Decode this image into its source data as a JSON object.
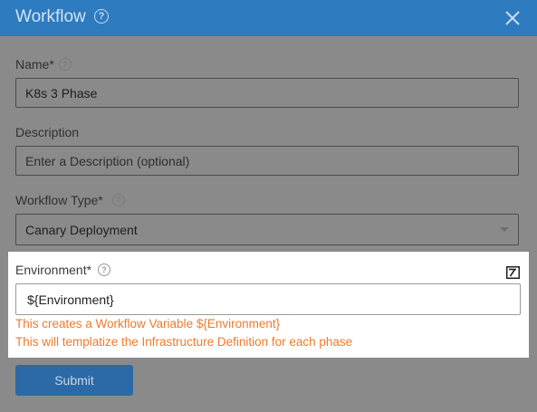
{
  "header": {
    "title": "Workflow",
    "help_glyph": "?",
    "close_icon": "close-icon"
  },
  "form": {
    "name": {
      "label": "Name*",
      "value": "K8s 3 Phase"
    },
    "description": {
      "label": "Description",
      "placeholder": "Enter a Description (optional)"
    },
    "workflow_type": {
      "label": "Workflow Type*",
      "selected": "Canary Deployment"
    },
    "environment": {
      "label": "Environment*",
      "value": "${Environment}",
      "template_icon": "templatize-icon",
      "hints": [
        "This creates a Workflow Variable ${Environment}",
        "This will templatize the Infrastructure Definition for each phase"
      ]
    },
    "submit_label": "Submit"
  },
  "colors": {
    "header_bg": "#2e7bbf",
    "hint_text": "#f07a2a",
    "submit_bg": "#2b6aa6"
  }
}
